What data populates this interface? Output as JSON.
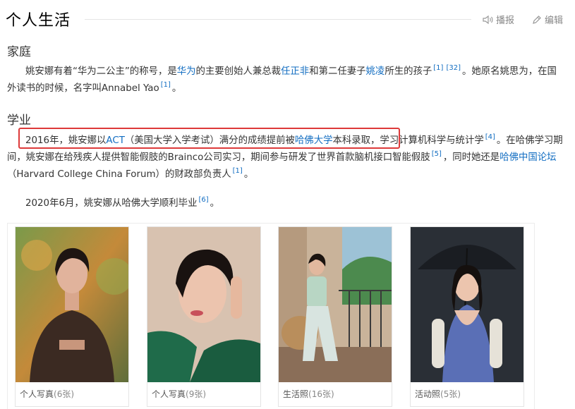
{
  "section": {
    "title": "个人生活",
    "play_label": "播报",
    "edit_label": "编辑"
  },
  "family": {
    "heading": "家庭",
    "p1_a": "姚安娜有着“华为二公主”的称号，是",
    "link_huawei": "华为",
    "p1_b": "的主要创始人兼总裁",
    "link_ren": "任正非",
    "p1_c": "和第二任妻子",
    "link_yaoling": "姚凌",
    "p1_d": "所生的孩子",
    "ref1": "[1]",
    "ref32": "[32]",
    "p1_e": "。她原名姚思为，在国外读书的时候，名字叫Annabel Yao",
    "ref1b": "[1]",
    "p1_f": "。"
  },
  "education": {
    "heading": "学业",
    "p2_a": "2016年，姚安娜以",
    "link_act": "ACT",
    "p2_b": "（美国大学入学考试）满分的成绩提前被",
    "link_harvard": "哈佛大学",
    "p2_c": "本科录取，学习计算机科学与统计学",
    "ref4": "[4]",
    "p2_d": "。在哈佛学习期间，姚安娜在给残疾人提供智能假肢的Brainco公司实习，期间参与研发了世界首款脑机接口智能假肢",
    "ref5": "[5]",
    "p2_e": "，同时她还是",
    "link_forum": "哈佛中国论坛",
    "p2_f": "（Harvard College China Forum）的财政部负责人",
    "ref1": "[1]",
    "p2_g": "。",
    "p3_a": "2020年6月，姚安娜从哈佛大学顺利毕业",
    "ref6": "[6]",
    "p3_b": "。"
  },
  "gallery": [
    {
      "label": "个人写真",
      "count": "(6张)"
    },
    {
      "label": "个人写真",
      "count": "(9张)"
    },
    {
      "label": "生活照",
      "count": "(16张)"
    },
    {
      "label": "活动照",
      "count": "(5张)"
    }
  ],
  "colors": {
    "link": "#136ec2",
    "highlight_border": "#dd3a3a"
  }
}
